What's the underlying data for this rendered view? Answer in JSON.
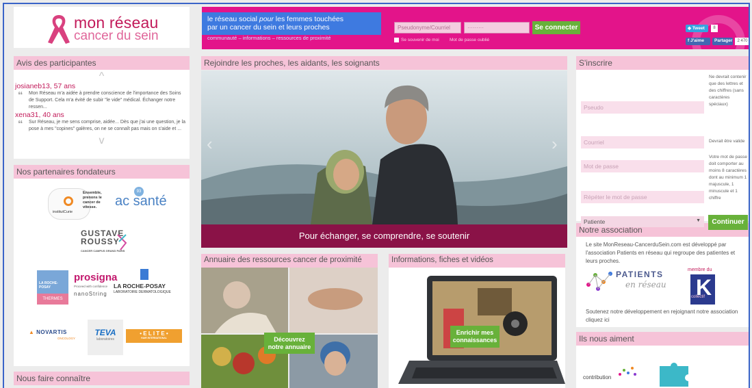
{
  "brand": {
    "logo_line1": "mon réseau",
    "logo_line2": "cancer du sein",
    "pink": "#e3148a",
    "blue": "#3e7ae0",
    "dark": "#8a1247",
    "green": "#68b13a"
  },
  "header": {
    "tagline_line1": "le réseau social ",
    "tagline_em": "pour",
    "tagline_line1b": " les femmes touchées",
    "tagline_line2": "par un cancer du sein et leurs proches",
    "subline": "communauté – informations – ressources de proximité",
    "login_placeholder": "Pseudonyme/Courriel",
    "password_value": "·········",
    "login_button": "Se connecter",
    "remember_label": "Se souvenir de moi",
    "forgot_label": "Mot de passe oublié"
  },
  "social": {
    "tweet_label": "Tweet",
    "tweet_count": "8",
    "like_label": "J'aime",
    "share_label": "Partager",
    "like_count": "2 470"
  },
  "reviews": {
    "title": "Avis des participantes",
    "items": [
      {
        "name": "josianeb13, 57 ans",
        "text": "Mon Réseau m'a aidée à prendre conscience de l'importance des Soins de Support. Cela m'a évité de subir \"le vide\" médical. Échanger notre ressen..."
      },
      {
        "name": "xena31, 40 ans",
        "text": "Sur Réseau, je me sens comprise, aidée... Dès que j'ai une question, je la pose à mes \"copines\" galères, on ne se connaît pas mais on s'aide et ..."
      }
    ]
  },
  "partners": {
    "title": "Nos partenaires fondateurs",
    "curie_text": "Ensemble, prenons le cancer de vitesse.",
    "curie_name": "institutCurie",
    "acsante": "ac santé",
    "acsante_num": "93",
    "gustave1": "GUSTAVE",
    "gustave2": "ROUSSY",
    "gustave3": "CANCER CAMPUS GRAND PARIS",
    "prosigna": "prosigna",
    "prosigna_sub": "Proceed with confidence",
    "nanostring": "nanoString",
    "lrp_box": "LA ROCHE-POSAY",
    "lrp_thermes": "THERMES",
    "lrp1": "LA ROCHE-POSAY",
    "lrp2": "LABORATOIRE DERMATOLOGIQUE",
    "novartis": "NOVARTIS",
    "novartis_sub": "ONCOLOGY",
    "teva": "TEVA",
    "teva_sub": "laboratoires",
    "elite": "• E L I T E •",
    "elite_sub": "HAIR INTERNATIONAL"
  },
  "promote": {
    "title": "Nous faire connaître"
  },
  "hero": {
    "title": "Rejoindre les proches, les aidants, les soignants",
    "caption": "Pour échanger, se comprendre, se soutenir",
    "prev": "‹",
    "next": "›"
  },
  "directory": {
    "title": "Annuaire des ressources cancer de proximité",
    "cta_line1": "Découvrez",
    "cta_line2": "notre annuaire"
  },
  "info": {
    "title": "Informations, fiches et vidéos",
    "cta_line1": "Enrichir mes",
    "cta_line2": "connaissances"
  },
  "signup": {
    "title": "S'inscrire",
    "pseudo_placeholder": "Pseudo",
    "pseudo_hint": "Ne devrait contenir que des lettres et des chiffres (sans caractères spéciaux)",
    "email_placeholder": "Courriel",
    "email_hint": "Devrait être valide",
    "password_placeholder": "Mot de passe",
    "password_hint": "Votre mot de passe doit comporter au moins 8 caractères dont au minimum 1 majuscule, 1 minuscule et 1 chiffre",
    "repeat_placeholder": "Répéter le mot de passe",
    "role_selected": "Patiente",
    "continue_button": "Continuer"
  },
  "association": {
    "title": "Notre association",
    "intro": "Le site MonReseau-CancerduSein.com est développé par l'association Patients en réseau qui regroupe des patientes et leurs proches.",
    "logo_line1": "PATIENTS",
    "logo_line2": "en réseau",
    "member_label": "membre du",
    "collectif": "collectif",
    "support": "Soutenez notre développement en rejoignant notre association cliquez ici"
  },
  "likes": {
    "title": "Ils nous aiment",
    "logo_label": "contribution"
  }
}
